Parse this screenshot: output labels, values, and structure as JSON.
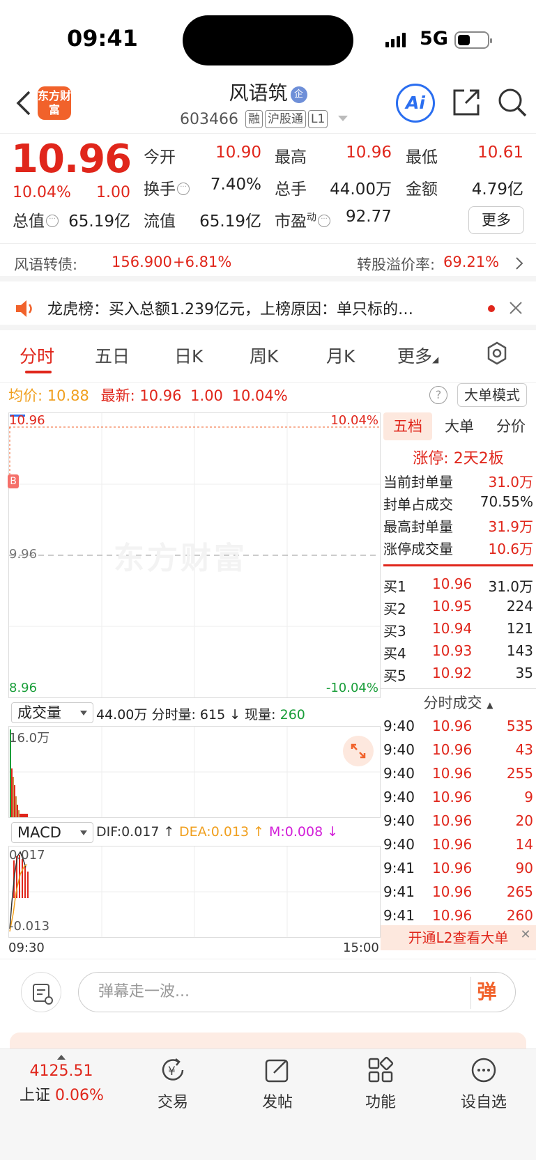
{
  "status": {
    "time": "09:41",
    "network": "5G"
  },
  "nav": {
    "logo_text": "东方财富",
    "name": "风语筑",
    "badge": "企",
    "code": "603466",
    "tags": [
      "融",
      "沪股通",
      "L1"
    ],
    "ai_label": "Ai"
  },
  "quote": {
    "price": "10.96",
    "change_pct": "10.04%",
    "change": "1.00",
    "fields": [
      {
        "label": "今开",
        "value": "10.90"
      },
      {
        "label": "最高",
        "value": "10.96"
      },
      {
        "label": "最低",
        "value": "10.61"
      },
      {
        "label": "换手",
        "value": "7.40%"
      },
      {
        "label": "总手",
        "value": "44.00万"
      },
      {
        "label": "金额",
        "value": "4.79亿"
      },
      {
        "label": "总值",
        "value": "65.19亿"
      },
      {
        "label": "流值",
        "value": "65.19亿"
      },
      {
        "label": "市盈",
        "sup": "动",
        "value": "92.77"
      }
    ],
    "more_label": "更多"
  },
  "bond": {
    "label": "风语转债:",
    "price": "156.900",
    "pct": "+6.81%",
    "premium_label": "转股溢价率:",
    "premium": "69.21%"
  },
  "notice": {
    "text": "龙虎榜：买入总额1.239亿元，上榜原因：单只标的…"
  },
  "tabs": [
    "分时",
    "五日",
    "日K",
    "周K",
    "月K",
    "更多"
  ],
  "info": {
    "avg_label": "均价:",
    "avg": "10.88",
    "last_label": "最新:",
    "last": "10.96",
    "chg": "1.00",
    "pct": "10.04%",
    "mode_label": "大单模式"
  },
  "chart": {
    "top_price": "10.96",
    "top_pct": "10.04%",
    "mid_price": "9.96",
    "bottom_price": "8.96",
    "bottom_pct": "-10.04%",
    "marker": "B",
    "watermark": "东方财富",
    "time_start": "09:30",
    "time_end": "15:00"
  },
  "volume": {
    "selector": "成交量",
    "total": "44.00万",
    "fenshi_label": "分时量:",
    "fenshi": "615",
    "now_label": "现量:",
    "now": "260",
    "axis_max": "16.0万"
  },
  "macd": {
    "selector": "MACD",
    "dif": "DIF:0.017",
    "dea": "DEA:0.013",
    "m": "M:0.008",
    "axis_max": "0.017",
    "axis_min": "-0.013"
  },
  "panel": {
    "tabs": [
      "五档",
      "大单",
      "分价"
    ],
    "limit": "涨停: 2天2板",
    "stats": [
      {
        "label": "当前封单量",
        "value": "31.0万"
      },
      {
        "label": "封单占成交",
        "value": "70.55%"
      },
      {
        "label": "最高封单量",
        "value": "31.9万"
      },
      {
        "label": "涨停成交量",
        "value": "10.6万"
      }
    ],
    "bids": [
      {
        "label": "买1",
        "price": "10.96",
        "vol": "31.0万"
      },
      {
        "label": "买2",
        "price": "10.95",
        "vol": "224"
      },
      {
        "label": "买3",
        "price": "10.94",
        "vol": "121"
      },
      {
        "label": "买4",
        "price": "10.93",
        "vol": "143"
      },
      {
        "label": "买5",
        "price": "10.92",
        "vol": "35"
      }
    ],
    "ticks_title": "分时成交",
    "ticks": [
      {
        "t": "9:40",
        "p": "10.96",
        "v": "535",
        "dir": "up"
      },
      {
        "t": "9:40",
        "p": "10.96",
        "v": "43",
        "dir": "up"
      },
      {
        "t": "9:40",
        "p": "10.96",
        "v": "255",
        "dir": "up"
      },
      {
        "t": "9:40",
        "p": "10.96",
        "v": "9",
        "dir": "up"
      },
      {
        "t": "9:40",
        "p": "10.96",
        "v": "20",
        "dir": "up"
      },
      {
        "t": "9:40",
        "p": "10.96",
        "v": "14",
        "dir": "up"
      },
      {
        "t": "9:41",
        "p": "10.96",
        "v": "90",
        "dir": "up"
      },
      {
        "t": "9:41",
        "p": "10.96",
        "v": "265",
        "dir": "up"
      },
      {
        "t": "9:41",
        "p": "10.96",
        "v": "260",
        "dir": "up"
      }
    ],
    "l2_label": "开通L2查看大单"
  },
  "comment": {
    "placeholder": "弹幕走一波...",
    "danmu": "弹"
  },
  "tabbar": {
    "index_value": "4125.51",
    "index_name": "上证",
    "index_pct": "0.06%",
    "items": [
      "交易",
      "发帖",
      "功能",
      "设自选"
    ]
  },
  "colors": {
    "up": "#e0261b",
    "down": "#1a9e3a",
    "accent": "#f1622b",
    "avg_line": "#f0a020"
  }
}
